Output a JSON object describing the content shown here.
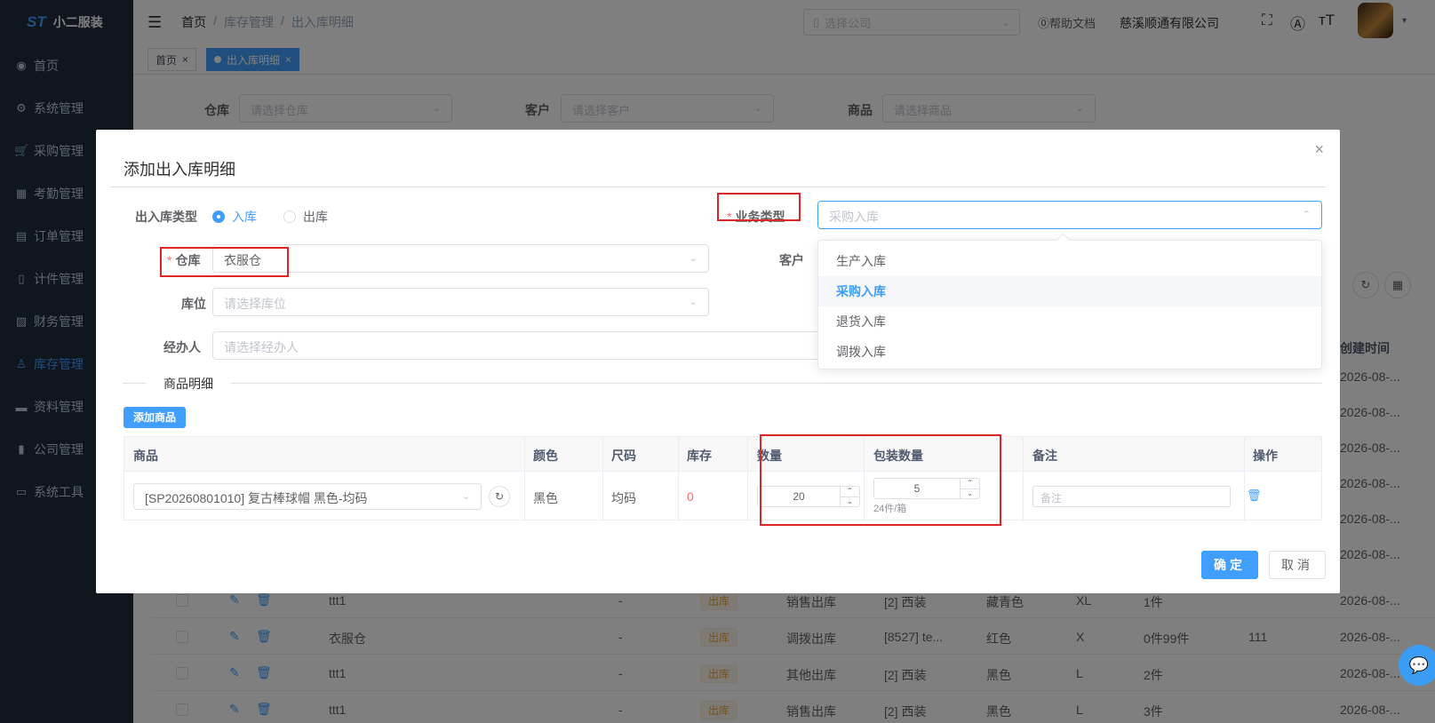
{
  "app": {
    "logo_mark": "ST",
    "name": "小二服装"
  },
  "sidebar": {
    "items": [
      {
        "icon": "dashboard-icon",
        "glyph": "◉",
        "label": "首页"
      },
      {
        "icon": "gear-icon",
        "glyph": "⚙",
        "label": "系统管理"
      },
      {
        "icon": "cart-icon",
        "glyph": "🛒",
        "label": "采购管理"
      },
      {
        "icon": "grid-icon",
        "glyph": "▦",
        "label": "考勤管理"
      },
      {
        "icon": "order-icon",
        "glyph": "▤",
        "label": "订单管理"
      },
      {
        "icon": "book-icon",
        "glyph": "▯",
        "label": "计件管理"
      },
      {
        "icon": "chart-icon",
        "glyph": "▨",
        "label": "财务管理"
      },
      {
        "icon": "user-icon",
        "glyph": "♙",
        "label": "库存管理"
      },
      {
        "icon": "document-icon",
        "glyph": "▬",
        "label": "资料管理"
      },
      {
        "icon": "bar-chart-icon",
        "glyph": "▮",
        "label": "公司管理"
      },
      {
        "icon": "toolbox-icon",
        "glyph": "▭",
        "label": "系统工具"
      }
    ],
    "active_index": 7
  },
  "header": {
    "hamburger_glyph": "☰",
    "breadcrumb": [
      "首页",
      "/",
      "库存管理",
      "/",
      "出入库明细"
    ],
    "company_select_placeholder": "选择公司",
    "help_label": "⓪帮助文档",
    "company_name": "慈溪顺通有限公司",
    "fullscreen_glyph": "⛶",
    "font_glyph": "Ⓐ",
    "size_glyph": "ᴛT",
    "caret_glyph": "▾"
  },
  "tags": [
    {
      "label": "首页",
      "close": "×"
    },
    {
      "label": "出入库明细",
      "close": "×"
    }
  ],
  "background": {
    "filters": [
      {
        "label": "仓库",
        "placeholder": "请选择仓库"
      },
      {
        "label": "客户",
        "placeholder": "请选择客户"
      },
      {
        "label": "商品",
        "placeholder": "请选择商品"
      }
    ],
    "column_created": "创建时间",
    "created_trunc": "2026-08-...",
    "rows": [
      {
        "warehouse": "ttt1",
        "dash": "-",
        "direction": "出库",
        "biz": "销售出库",
        "product": "[2] 西装",
        "color": "藏青色",
        "size": "XL",
        "qty": "1件",
        "note": "",
        "created": "2026-08-..."
      },
      {
        "warehouse": "衣服仓",
        "dash": "-",
        "direction": "出库",
        "biz": "调拨出库",
        "product": "[8527] te...",
        "color": "红色",
        "size": "X",
        "qty": "0件99件",
        "note": "111",
        "created": "2026-08-..."
      },
      {
        "warehouse": "ttt1",
        "dash": "-",
        "direction": "出库",
        "biz": "其他出库",
        "product": "[2] 西装",
        "color": "黑色",
        "size": "L",
        "qty": "2件",
        "note": "",
        "created": "2026-08-..."
      },
      {
        "warehouse": "ttt1",
        "dash": "-",
        "direction": "出库",
        "biz": "销售出库",
        "product": "[2] 西装",
        "color": "黑色",
        "size": "L",
        "qty": "3件",
        "note": "",
        "created": "2026-08-..."
      }
    ],
    "refresh_glyph": "↻",
    "grid_glyph": "▦"
  },
  "dialog": {
    "title": "添加出入库明细",
    "close_glyph": "×",
    "io_type_label": "出入库类型",
    "radio_in": "入库",
    "radio_out": "出库",
    "biz_type_label": "业务类型",
    "biz_type_placeholder": "采购入库",
    "warehouse_label": "仓库",
    "warehouse_value": "衣服仓",
    "customer_label": "客户",
    "location_label": "库位",
    "location_placeholder": "请选择库位",
    "handler_label": "经办人",
    "handler_placeholder": "请选择经办人",
    "required_mark": "*",
    "chevron_down": "⌄",
    "chevron_up": "⌃",
    "dropdown_options": [
      "生产入库",
      "采购入库",
      "退货入库",
      "调拨入库"
    ],
    "dropdown_selected_index": 1,
    "section_title": "商品明细",
    "add_product_label": "添加商品",
    "columns": [
      "商品",
      "颜色",
      "尺码",
      "库存",
      "数量",
      "包装数量",
      "备注",
      "操作"
    ],
    "row": {
      "product": "[SP20260801010] 复古棒球帽 黑色-均码",
      "refresh_glyph": "↻",
      "color": "黑色",
      "size": "均码",
      "stock": "0",
      "quantity": "20",
      "package_qty": "5",
      "package_note": "24件/箱",
      "note_placeholder": "备注",
      "delete_glyph": "🗑",
      "up_glyph": "⌃",
      "down_glyph": "⌄"
    },
    "confirm_label": "确定",
    "cancel_label": "取消"
  },
  "chat_glyph": "💬",
  "colors": {
    "primary": "#409eff",
    "sidebar_bg": "#1f2d3d",
    "danger": "#f56c6c",
    "highlight_box": "#e02424"
  }
}
